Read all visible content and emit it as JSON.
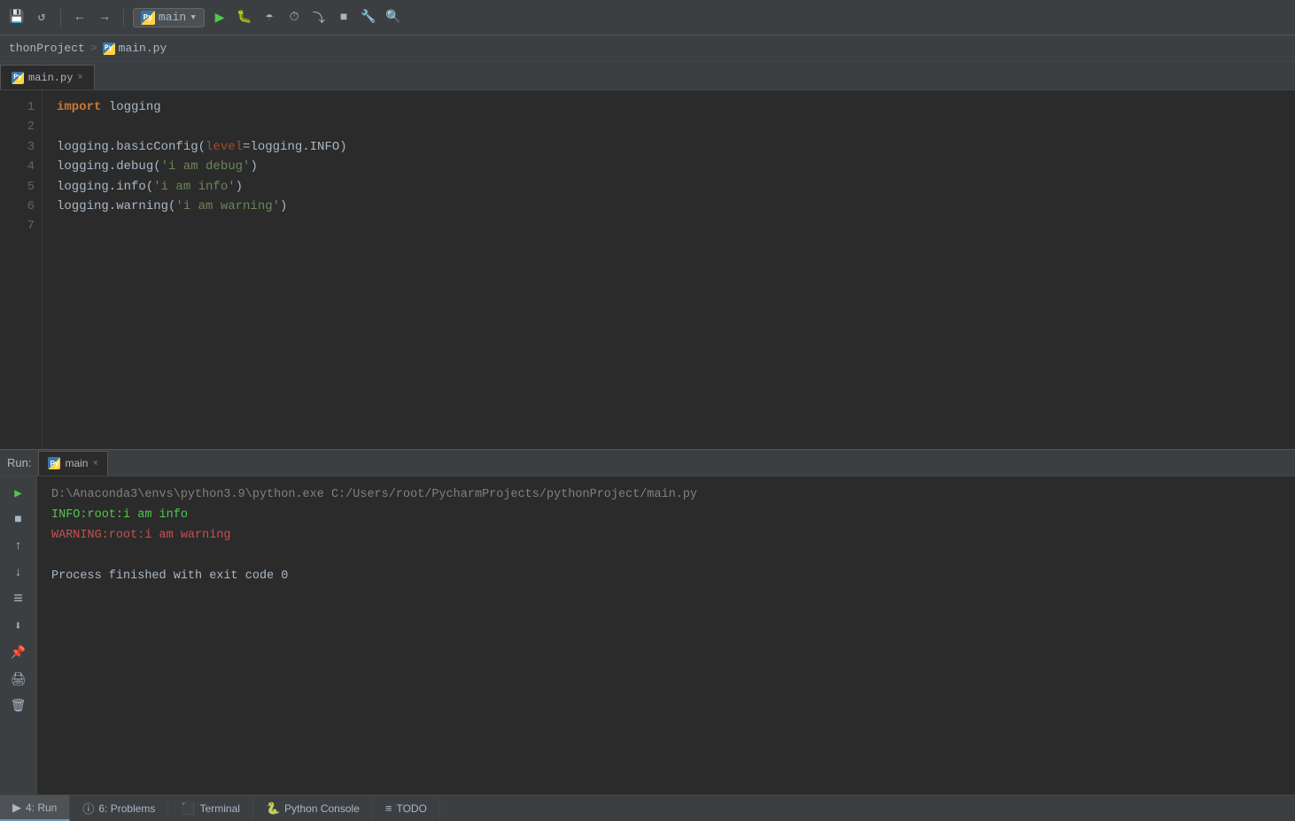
{
  "toolbar": {
    "save_icon": "💾",
    "refresh_icon": "↺",
    "back_icon": "←",
    "forward_icon": "→",
    "run_config": "main",
    "run_icon": "▶",
    "debug_icon": "🐛",
    "coverage_icon": "☂",
    "profile_icon": "⏱",
    "step_over_icon": "⤵",
    "stop_icon": "■",
    "wrench_icon": "🔧",
    "search_icon": "🔍"
  },
  "breadcrumb": {
    "project": "thonProject",
    "separator": ">",
    "file": "main.py"
  },
  "tab": {
    "filename": "main.py",
    "close": "×"
  },
  "code": {
    "lines": [
      {
        "num": "1",
        "content": [
          {
            "type": "kw",
            "text": "import"
          },
          {
            "type": "normal",
            "text": " logging"
          }
        ]
      },
      {
        "num": "2",
        "content": []
      },
      {
        "num": "3",
        "content": [
          {
            "type": "normal",
            "text": "logging.basicConfig("
          },
          {
            "type": "param",
            "text": "level"
          },
          {
            "type": "normal",
            "text": "=logging.INFO)"
          }
        ]
      },
      {
        "num": "4",
        "content": [
          {
            "type": "normal",
            "text": "logging.debug("
          },
          {
            "type": "str",
            "text": "'i am debug'"
          },
          {
            "type": "normal",
            "text": ")"
          }
        ]
      },
      {
        "num": "5",
        "content": [
          {
            "type": "normal",
            "text": "logging.info("
          },
          {
            "type": "str",
            "text": "'i am info'"
          },
          {
            "type": "normal",
            "text": ")"
          }
        ]
      },
      {
        "num": "6",
        "content": [
          {
            "type": "normal",
            "text": "logging.warning("
          },
          {
            "type": "str",
            "text": "'i am warning'"
          },
          {
            "type": "normal",
            "text": ")"
          }
        ]
      },
      {
        "num": "7",
        "content": []
      }
    ]
  },
  "run_panel": {
    "label": "Run:",
    "tab_name": "main",
    "tab_close": "×",
    "output_lines": [
      {
        "type": "gray",
        "text": "D:\\Anaconda3\\envs\\python3.9\\python.exe C:/Users/root/PycharmProjects/pythonProject/main.py"
      },
      {
        "type": "info",
        "text": "INFO:root:i am info"
      },
      {
        "type": "warning",
        "text": "WARNING:root:i am warning"
      },
      {
        "type": "normal",
        "text": ""
      },
      {
        "type": "normal",
        "text": "Process finished with exit code 0"
      }
    ],
    "sidebar_buttons": [
      {
        "icon": "▶",
        "active": true,
        "name": "play"
      },
      {
        "icon": "■",
        "active": false,
        "name": "stop"
      },
      {
        "icon": "↑",
        "active": false,
        "name": "scroll-up"
      },
      {
        "icon": "↓",
        "active": false,
        "name": "scroll-down"
      },
      {
        "icon": "≡",
        "active": false,
        "name": "menu"
      },
      {
        "icon": "⬇",
        "active": false,
        "name": "download"
      },
      {
        "icon": "📌",
        "active": false,
        "name": "pin"
      },
      {
        "icon": "🖨",
        "active": false,
        "name": "print"
      },
      {
        "icon": "🗑",
        "active": false,
        "name": "delete"
      }
    ]
  },
  "status_bar": {
    "items": [
      {
        "icon": "▶",
        "label": "4: Run",
        "active": true
      },
      {
        "icon": "ⓘ",
        "label": "6: Problems",
        "active": false
      },
      {
        "icon": "⬛",
        "label": "Terminal",
        "active": false
      },
      {
        "icon": "🐍",
        "label": "Python Console",
        "active": false
      },
      {
        "icon": "≡",
        "label": "TODO",
        "active": false
      }
    ]
  }
}
